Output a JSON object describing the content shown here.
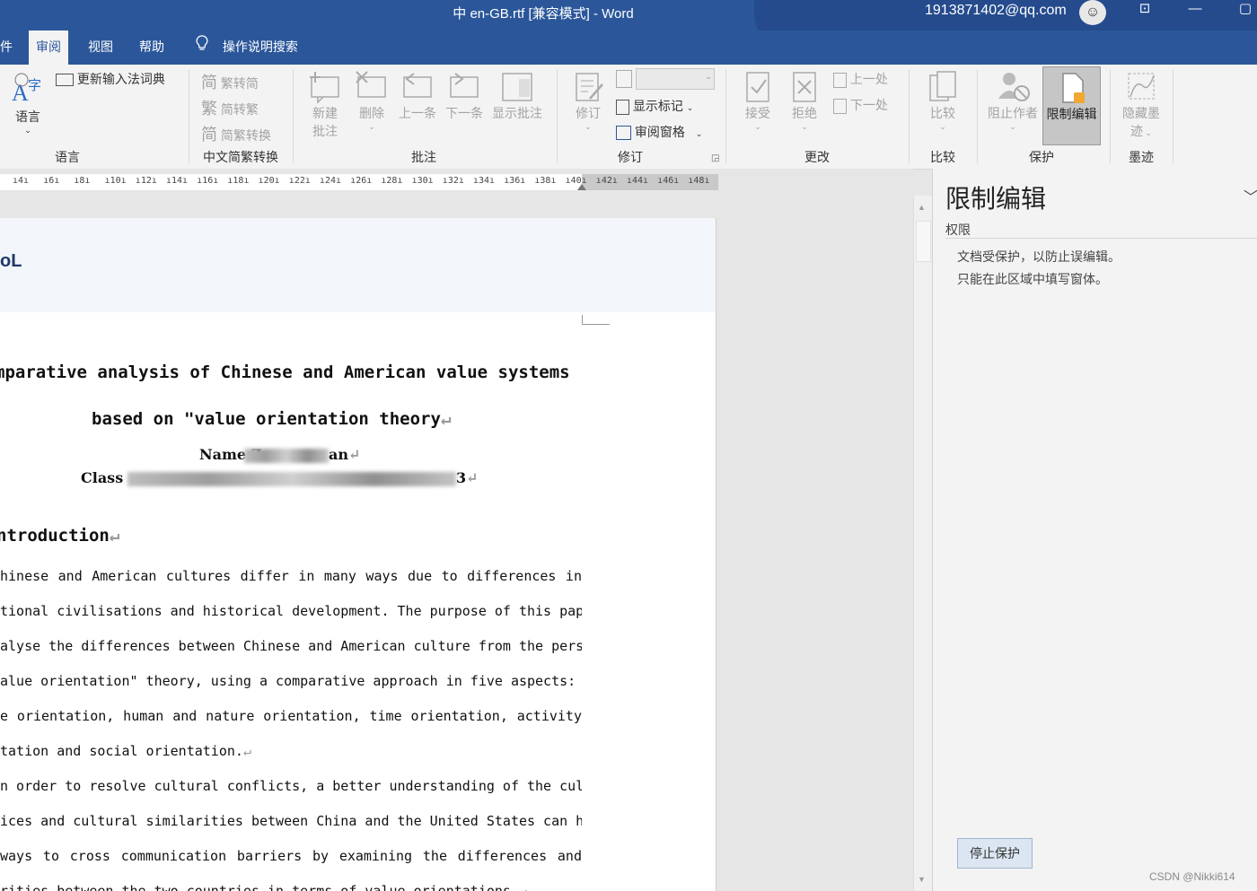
{
  "window": {
    "title": "中 en-GB.rtf [兼容模式]  -  Word",
    "user_email": "1913871402@qq.com",
    "accent_color": "#2b579a"
  },
  "tabs": [
    {
      "label": "件"
    },
    {
      "label": "审阅",
      "active": true
    },
    {
      "label": "视图"
    },
    {
      "label": "帮助"
    },
    {
      "label": "操作说明搜索"
    }
  ],
  "ribbon": {
    "language": {
      "lang_button": "语言",
      "update_dict": "更新输入法词典",
      "group": "语言"
    },
    "chinese_conversion": {
      "trad_to_simp": "繁转简",
      "simp_to_trad": "简转繁",
      "convert": "简繁转换",
      "group": "中文简繁转换"
    },
    "comments": {
      "new_line1": "新建",
      "new_line2": "批注",
      "delete": "删除",
      "previous": "上一条",
      "next": "下一条",
      "show": "显示批注",
      "group": "批注"
    },
    "tracking": {
      "track": "修订",
      "show_markup": "显示标记",
      "reviewing_pane": "审阅窗格",
      "group": "修订"
    },
    "changes": {
      "accept": "接受",
      "reject": "拒绝",
      "previous": "上一处",
      "next": "下一处",
      "group": "更改"
    },
    "compare": {
      "compare": "比较",
      "group": "比较"
    },
    "protect": {
      "block_authors": "阻止作者",
      "restrict_editing": "限制编辑",
      "group": "保护"
    },
    "ink": {
      "hide_ink_line1": "隐藏墨",
      "hide_ink_line2": "迹",
      "group": "墨迹"
    }
  },
  "ruler": {
    "ticks": [
      "4",
      "6",
      "8",
      "10",
      "12",
      "14",
      "16",
      "18",
      "20",
      "22",
      "24",
      "26",
      "28",
      "30",
      "32",
      "34",
      "36",
      "38",
      "40",
      "42",
      "44",
      "46",
      "48"
    ]
  },
  "document": {
    "banner_text": "oL",
    "title_line1": "mparative analysis of Chinese and American value systems",
    "title_line2": "based on \"value orientation theory",
    "name_label": "Name Z",
    "name_end": "an",
    "class_label": "Class",
    "class_end": "3",
    "heading": "ntroduction",
    "paragraph_lines": [
      "hinese and American cultures differ in many ways due to differences in",
      "tional civilisations and historical development. The purpose of this paper is",
      "alyse the differences between Chinese and American culture from the perspective",
      "alue orientation\" theory, using a comparative approach in five aspects: human",
      "e orientation, human and nature orientation, time orientation, activity",
      "tation and social orientation.",
      "n order to resolve cultural conflicts, a better understanding of the cultural",
      "ices and cultural similarities between China and the United States can help",
      " ways to cross communication barriers by examining the differences and",
      "rities between the two countries in terms of value orientations."
    ]
  },
  "pane": {
    "title": "限制编辑",
    "section": "权限",
    "message_line1": "文档受保护，以防止误编辑。",
    "message_line2": "只能在此区域中填写窗体。",
    "stop_button": "停止保护"
  },
  "watermark": "CSDN @Nikki614"
}
